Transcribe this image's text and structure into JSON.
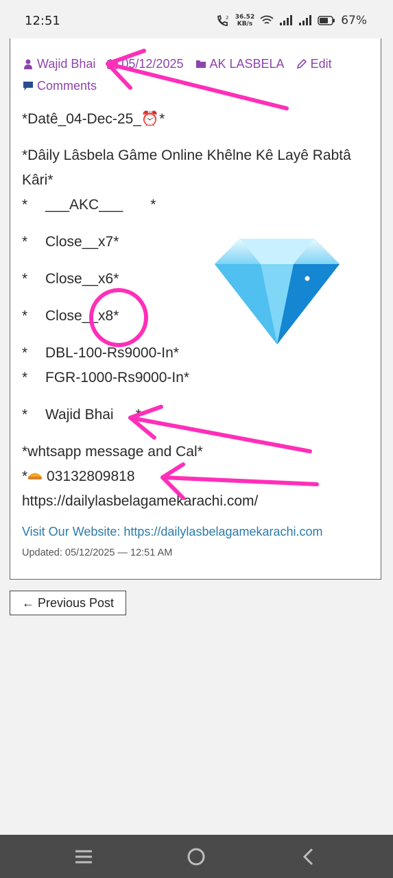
{
  "status_bar": {
    "time": "12:51",
    "speed_value": "36.52",
    "speed_unit": "KB/s",
    "battery": "67%"
  },
  "post": {
    "author": "Wajid Bhai",
    "date": "05/12/2025",
    "category": "AK LASBELA",
    "edit_label": "Edit",
    "comments_label": "Comments",
    "lines": {
      "date_line": "*Datê_04-Dec-25_⏰*",
      "title_1": "*Dâily Lâsbela Gâme Online Khêlne Kê Layê Rabtâ",
      "title_2": "Kâri*",
      "akc_star": "*",
      "akc": "___AKC___",
      "akc_end": "*",
      "close1_star": "*",
      "close1": "Close__x7*",
      "close2_star": "*",
      "close2": "Close__x6*",
      "close3_star": "*",
      "close3": "Close__x8*",
      "dbl_star": "*",
      "dbl": "DBL-100-Rs9000-In*",
      "fgr_star": "*",
      "fgr": "FGR-1000-Rs9000-In*",
      "wajid_star": "*",
      "wajid": "Wajid Bhai",
      "wajid_end": "*",
      "whatsapp": "*whtsapp message and Cal*",
      "phone_prefix": "*",
      "phone": "03132809818",
      "url": "https://dailylasbelagamekarachi.com/"
    },
    "website_link": "Visit Our Website: https://dailylasbelagamekarachi.com",
    "updated": "Updated: 05/12/2025 — 12:51 AM"
  },
  "prev_post_label": "← Previous Post",
  "colors": {
    "meta_purple": "#8e44ad",
    "link_blue": "#2a7bab",
    "annotation_pink": "#ff2fb9"
  }
}
